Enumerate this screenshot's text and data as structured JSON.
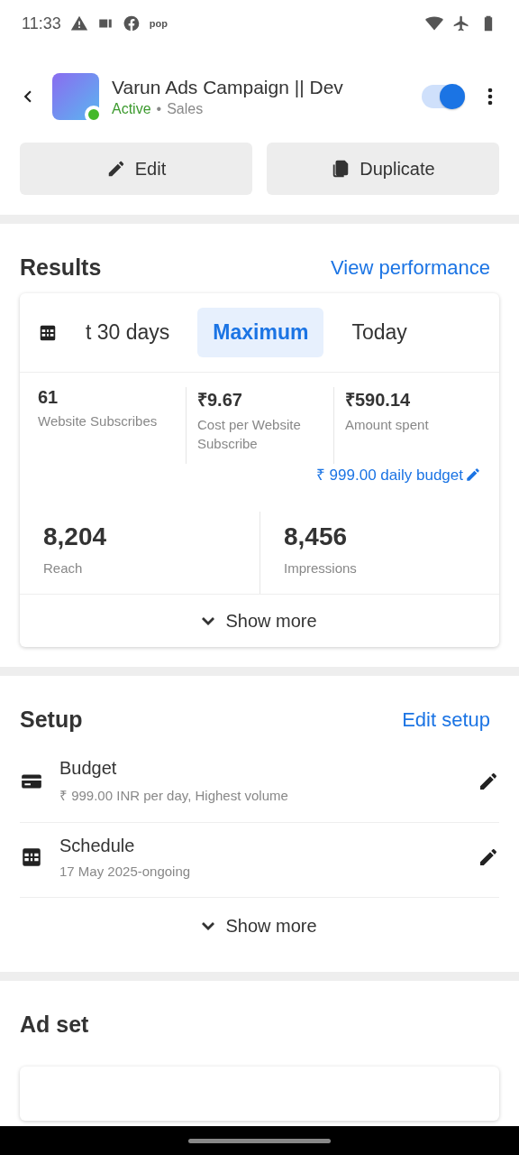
{
  "status_bar": {
    "time": "11:33",
    "app_badge": "pop"
  },
  "header": {
    "title": "Varun Ads Campaign || Dev",
    "status": "Active",
    "separator": "•",
    "category": "Sales",
    "online": true,
    "toggle_on": true
  },
  "actions": [
    {
      "kind": "edit",
      "label": "Edit"
    },
    {
      "kind": "duplicate",
      "label": "Duplicate"
    }
  ],
  "results": {
    "title": "Results",
    "link": "View performance",
    "ranges": [
      {
        "label": "t 30 days",
        "selected": false
      },
      {
        "label": "Maximum",
        "selected": true
      },
      {
        "label": "Today",
        "selected": false
      }
    ],
    "metrics": [
      {
        "value": "61",
        "label": "Website Subscribes"
      },
      {
        "value": "₹9.67",
        "label": "Cost per Website Subscribe"
      },
      {
        "value": "₹590.14",
        "label": "Amount spent"
      }
    ],
    "budget_link": "₹ 999.00 daily budget",
    "totals": [
      {
        "value": "8,204",
        "label": "Reach"
      },
      {
        "value": "8,456",
        "label": "Impressions"
      }
    ],
    "show_more": "Show more"
  },
  "setup": {
    "title": "Setup",
    "link": "Edit setup",
    "rows": [
      {
        "kind": "budget",
        "title": "Budget",
        "detail": "₹ 999.00 INR per day, Highest volume"
      },
      {
        "kind": "schedule",
        "title": "Schedule",
        "detail": "17 May 2025-ongoing"
      }
    ],
    "show_more": "Show more"
  },
  "ad_set": {
    "title": "Ad set"
  }
}
